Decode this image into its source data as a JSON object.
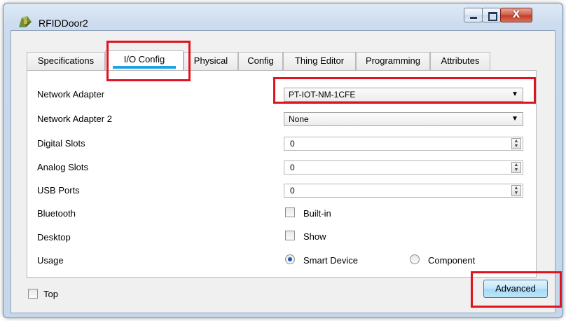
{
  "window": {
    "title": "RFIDDoor2",
    "close_glyph": "X"
  },
  "tabs": [
    {
      "label": "Specifications"
    },
    {
      "label": "I/O Config"
    },
    {
      "label": "Physical"
    },
    {
      "label": "Config"
    },
    {
      "label": "Thing Editor"
    },
    {
      "label": "Programming"
    },
    {
      "label": "Attributes"
    }
  ],
  "active_tab": "I/O Config",
  "form": {
    "network_adapter": {
      "label": "Network Adapter",
      "value": "PT-IOT-NM-1CFE"
    },
    "network_adapter_2": {
      "label": "Network Adapter 2",
      "value": "None"
    },
    "digital_slots": {
      "label": "Digital Slots",
      "value": "0"
    },
    "analog_slots": {
      "label": "Analog Slots",
      "value": "0"
    },
    "usb_ports": {
      "label": "USB Ports",
      "value": "0"
    },
    "bluetooth": {
      "label": "Bluetooth",
      "option": "Built-in",
      "checked": false
    },
    "desktop": {
      "label": "Desktop",
      "option": "Show",
      "checked": false
    },
    "usage": {
      "label": "Usage",
      "options": [
        "Smart Device",
        "Component"
      ],
      "selected": "Smart Device"
    }
  },
  "footer": {
    "top_label": "Top",
    "top_checked": false,
    "advanced_label": "Advanced"
  },
  "colors": {
    "highlight": "#e0141e",
    "tab_underline": "#1ea1e6"
  }
}
